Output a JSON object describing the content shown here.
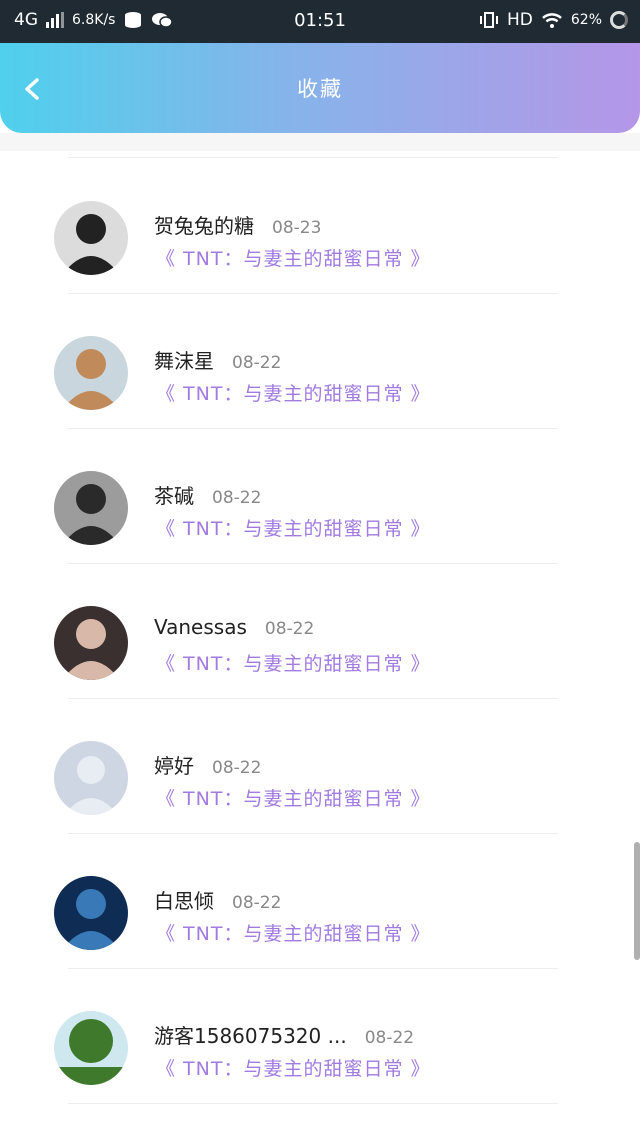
{
  "status_bar": {
    "network": "4G",
    "speed": "6.8K/s",
    "time": "01:51",
    "hd": "HD",
    "battery": "62%"
  },
  "header": {
    "title": "收藏",
    "back_icon": "chevron-left-icon"
  },
  "favorites": [
    {
      "name": "贺兔兔的糖",
      "date": "08-23",
      "book": "《 TNT：与妻主的甜蜜日常 》",
      "avatar_colors": [
        "#dcdcdc",
        "#222222"
      ]
    },
    {
      "name": "舞沫星",
      "date": "08-22",
      "book": "《 TNT：与妻主的甜蜜日常 》",
      "avatar_colors": [
        "#c9d6de",
        "#c08a5a"
      ]
    },
    {
      "name": "茶碱",
      "date": "08-22",
      "book": "《 TNT：与妻主的甜蜜日常 》",
      "avatar_colors": [
        "#9c9c9c",
        "#2a2a2a"
      ]
    },
    {
      "name": "Vanessas",
      "date": "08-22",
      "book": "《 TNT：与妻主的甜蜜日常 》",
      "avatar_colors": [
        "#3a3030",
        "#d8b8a8"
      ]
    },
    {
      "name": "婷好",
      "date": "08-22",
      "book": "《 TNT：与妻主的甜蜜日常 》",
      "avatar_colors": [
        "#cdd6e2",
        "#e8edf3"
      ]
    },
    {
      "name": "白思倾",
      "date": "08-22",
      "book": "《 TNT：与妻主的甜蜜日常 》",
      "avatar_colors": [
        "#0f2c55",
        "#3a79b8"
      ]
    },
    {
      "name": "游客1586075320 ...",
      "date": "08-22",
      "book": "《 TNT：与妻主的甜蜜日常 》",
      "avatar_colors": [
        "#cfe8f0",
        "#3f7a2c"
      ]
    }
  ]
}
